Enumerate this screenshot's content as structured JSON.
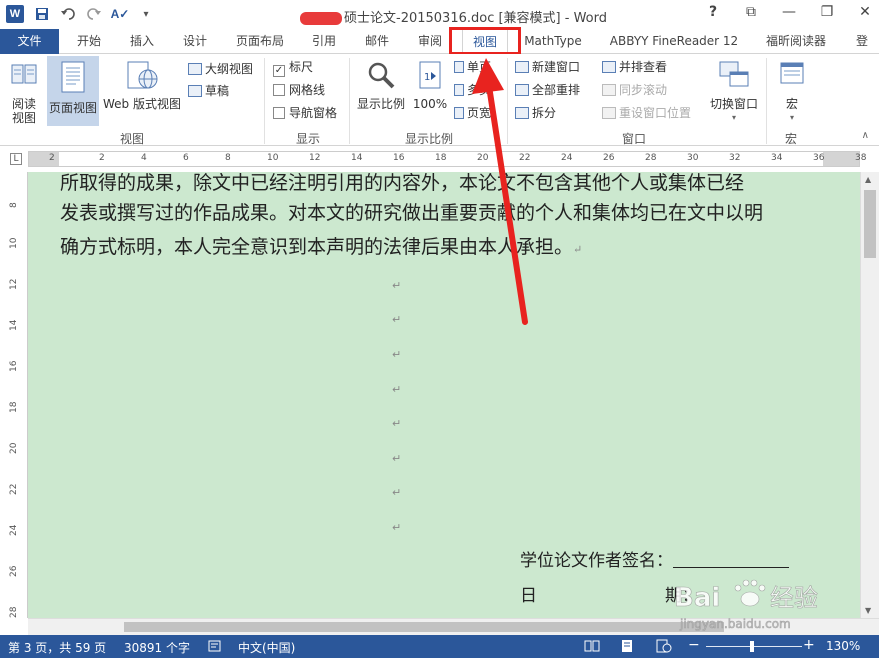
{
  "app": {
    "title": "硕士论文-20150316.doc [兼容模式] - Word",
    "logo": "W"
  },
  "quick_access": [
    {
      "icon": "word-app-icon"
    },
    {
      "icon": "save-icon"
    },
    {
      "icon": "undo-icon"
    },
    {
      "icon": "redo-icon"
    },
    {
      "icon": "spelling-icon"
    },
    {
      "icon": "customize-qat-icon"
    }
  ],
  "window_controls": {
    "help": "?",
    "ribbon_options": "⧉",
    "minimize": "—",
    "restore": "❐",
    "close": "✕"
  },
  "tabs": [
    {
      "label": "文件"
    },
    {
      "label": "开始"
    },
    {
      "label": "插入"
    },
    {
      "label": "设计"
    },
    {
      "label": "页面布局"
    },
    {
      "label": "引用"
    },
    {
      "label": "邮件"
    },
    {
      "label": "审阅"
    },
    {
      "label": "视图",
      "active": true
    },
    {
      "label": "MathType"
    },
    {
      "label": "ABBYY FineReader 12"
    },
    {
      "label": "福昕阅读器"
    },
    {
      "label": "登"
    }
  ],
  "ribbon": {
    "views": {
      "label": "视图",
      "read_mode": "阅读\n视图",
      "print_layout": "页面视图",
      "web_layout": "Web 版式视图",
      "outline": "大纲视图",
      "draft": "草稿"
    },
    "show": {
      "label": "显示",
      "ruler": "标尺",
      "gridlines": "网格线",
      "nav_pane": "导航窗格",
      "ruler_checked": true,
      "gridlines_checked": false,
      "nav_pane_checked": false
    },
    "zoom": {
      "label": "显示比例",
      "zoom_btn": "显示比例",
      "pct_btn": "100%",
      "one_page": "单页",
      "multi_page": "多页",
      "page_width": "页宽"
    },
    "window": {
      "label": "窗口",
      "new_window": "新建窗口",
      "arrange_all": "全部重排",
      "split": "拆分",
      "side_by_side": "并排查看",
      "sync_scroll": "同步滚动",
      "reset_position": "重设窗口位置",
      "switch_windows": "切换窗口"
    },
    "macros": {
      "label": "宏",
      "macros_btn": "宏"
    }
  },
  "ruler": {
    "corner": "L",
    "h_ticks": [
      "2",
      "2",
      "4",
      "6",
      "8",
      "10",
      "12",
      "14",
      "16",
      "18",
      "20",
      "22",
      "24",
      "26",
      "28",
      "30",
      "32",
      "34",
      "36",
      "38"
    ],
    "v_ticks": [
      "8",
      "10",
      "12",
      "14",
      "16",
      "18",
      "20",
      "22",
      "24",
      "26",
      "28"
    ]
  },
  "document": {
    "line1": "所取得的成果，除文中已经注明引用的内容外，本论文不包含其他个人或集体已经",
    "line2": "发表或撰写过的作品成果。对本文的研究做出重要贡献的个人和集体均已在文中以明",
    "line3": "确方式标明，本人完全意识到本声明的法律后果由本人承担。",
    "para_mark": "↵",
    "signature_label": "学位论文作者签名：",
    "date_label_1": "日",
    "date_label_2": "期："
  },
  "status_bar": {
    "page": "第 3 页，共 59 页",
    "words": "30891 个字",
    "language": "中文(中国)",
    "zoom": "130%",
    "zoom_fraction": 0.48
  },
  "colors": {
    "accent": "#2b579a",
    "doc_background": "#cce8cf",
    "highlight": "#e8231f"
  }
}
